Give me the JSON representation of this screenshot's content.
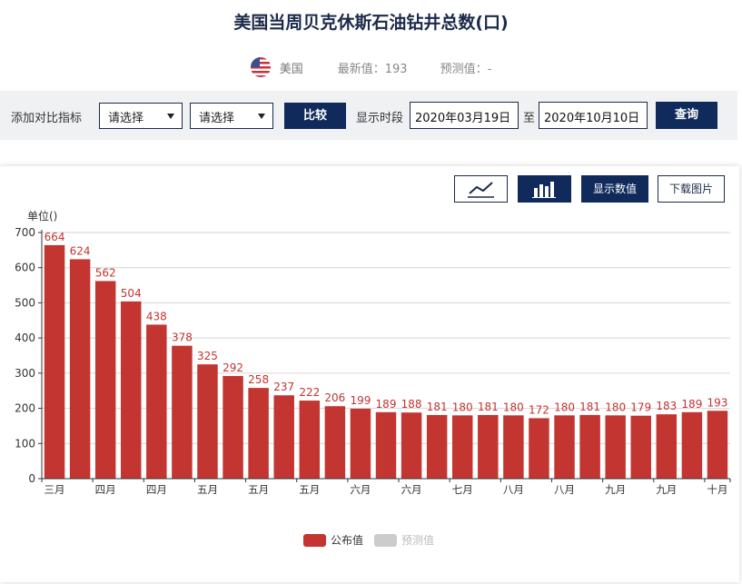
{
  "title": "美国当周贝克休斯石油钻井总数(口)",
  "meta": {
    "country": "美国",
    "latest_label": "最新值：",
    "latest_value": "193",
    "forecast_label": "预测值：",
    "forecast_value": "-"
  },
  "filter": {
    "compare_label": "添加对比指标",
    "select1": "请选择",
    "select2": "请选择",
    "compare_button": "比较",
    "time_label": "显示时段",
    "start_date": "2020年03月19日",
    "to_label": "至",
    "end_date": "2020年10月10日",
    "query_button": "查询"
  },
  "toolbar": {
    "line_icon": "line-chart-icon",
    "bar_icon": "bar-chart-icon",
    "show_values": "显示数值",
    "download": "下载图片"
  },
  "colors": {
    "bar": "#c23531",
    "forecast": "#cccccc",
    "navy": "#102a5c"
  },
  "chart_data": {
    "type": "bar",
    "ylabel": "单位()",
    "ylim": [
      0,
      700
    ],
    "yticks": [
      0,
      100,
      200,
      300,
      400,
      500,
      600,
      700
    ],
    "tick_labels": [
      "三月",
      "四月",
      "四月",
      "五月",
      "五月",
      "五月",
      "六月",
      "六月",
      "七月",
      "八月",
      "八月",
      "九月",
      "九月",
      "十月"
    ],
    "values": [
      664,
      624,
      562,
      504,
      438,
      378,
      325,
      292,
      258,
      237,
      222,
      206,
      199,
      189,
      188,
      181,
      180,
      181,
      180,
      172,
      180,
      181,
      180,
      179,
      183,
      189,
      193
    ],
    "legend": [
      "公布值",
      "预测值"
    ],
    "legend_position": "bottom-center",
    "grid": true
  }
}
